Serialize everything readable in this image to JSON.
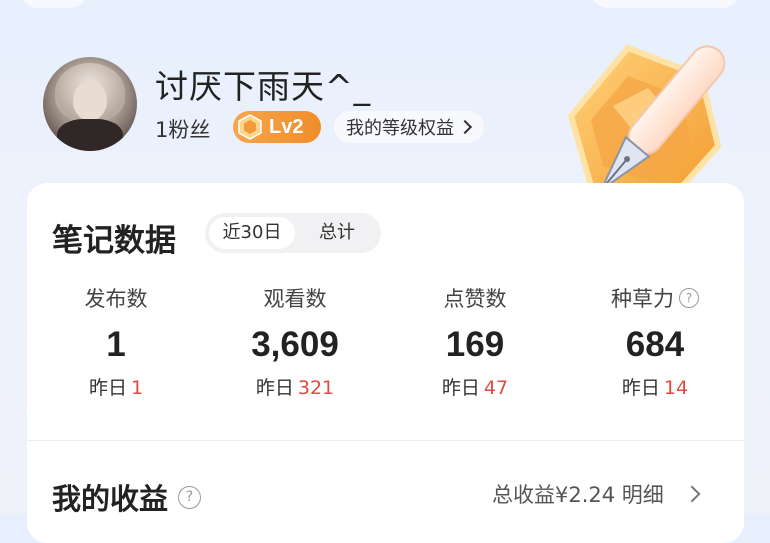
{
  "profile": {
    "username": "讨厌下雨天^_",
    "fans": "1粉丝",
    "level": "Lv2",
    "benefits_label": "我的等级权益"
  },
  "stats_card": {
    "title": "笔记数据",
    "tabs": [
      {
        "label": "近30日",
        "active": true
      },
      {
        "label": "总计",
        "active": false
      }
    ],
    "yesterday_prefix": "昨日",
    "stats": [
      {
        "label": "发布数",
        "value": "1",
        "yesterday": "1"
      },
      {
        "label": "观看数",
        "value": "3,609",
        "yesterday": "321"
      },
      {
        "label": "点赞数",
        "value": "169",
        "yesterday": "47"
      },
      {
        "label": "种草力",
        "value": "684",
        "yesterday": "14",
        "help_icon": "question-circle-icon"
      }
    ]
  },
  "income": {
    "title": "我的收益",
    "total": "总收益¥2.24 明细"
  },
  "colors": {
    "accent_orange": "#f08d2c",
    "highlight_red": "#e04a3f"
  }
}
